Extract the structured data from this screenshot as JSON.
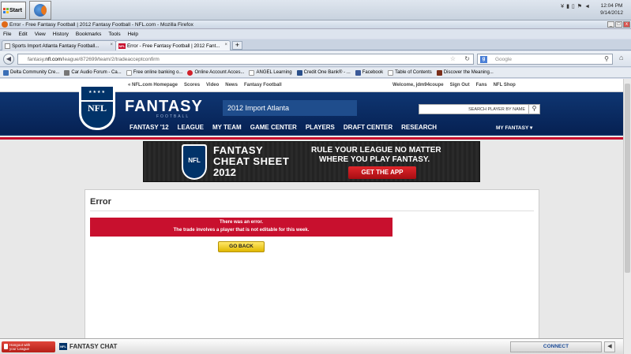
{
  "taskbar": {
    "start_label": "Start",
    "clock_time": "12:04 PM",
    "clock_date": "9/14/2012"
  },
  "window": {
    "title": "Error - Free Fantasy Football | 2012 Fantasy Football - NFL.com - Mozilla Firefox",
    "controls": [
      "_",
      "□",
      "x"
    ]
  },
  "menu": [
    "File",
    "Edit",
    "View",
    "History",
    "Bookmarks",
    "Tools",
    "Help"
  ],
  "tabs": [
    {
      "label": "Sports Import Atlanta Fantasy Football...",
      "active": false
    },
    {
      "label": "Error - Free Fantasy Football | 2012 Fant...",
      "active": true
    }
  ],
  "nav": {
    "url_prefix": "fantasy.",
    "url_domain": "nfl.com",
    "url_rest": "/league/872699/team/2/tradeacceptconfirm",
    "search_placeholder": "Google"
  },
  "bookmarks": [
    {
      "label": "Delta Community Cre...",
      "color": "#3b6fb6"
    },
    {
      "label": "Car Audio Forum - Ca...",
      "color": "#777777"
    },
    {
      "label": "Free online banking o...",
      "color": "#ffffff"
    },
    {
      "label": "Online Account Acces...",
      "color": "#d0202a"
    },
    {
      "label": "ANGEL Learning",
      "color": "#ffffff"
    },
    {
      "label": "Credit One Bank® - ...",
      "color": "#2a4f8a"
    },
    {
      "label": "Facebook",
      "color": "#3b5998"
    },
    {
      "label": "Table of Contents",
      "color": "#ffffff"
    },
    {
      "label": "Discover the Meaning...",
      "color": "#7a2e1a"
    }
  ],
  "nfl": {
    "top_left_links": [
      "« NFL.com Homepage",
      "Scores",
      "Video",
      "News",
      "Fantasy Football"
    ],
    "top_right_links": [
      "Welcome, jdm94coupe",
      "Sign Out",
      "Fans",
      "NFL Shop"
    ],
    "shield_text": "NFL",
    "brand": "FANTASY",
    "brand_sub": "FOOTBALL",
    "league_name": "2012 Import Atlanta",
    "player_search": "SEARCH PLAYER BY NAME",
    "main_nav": [
      "FANTASY '12",
      "LEAGUE",
      "MY TEAM",
      "GAME CENTER",
      "PLAYERS",
      "DRAFT CENTER",
      "RESEARCH"
    ],
    "my_fantasy": "MY FANTASY ▾"
  },
  "banner": {
    "line1": "FANTASY",
    "line2": "CHEAT SHEET",
    "line3": "2012",
    "tag1": "RULE YOUR LEAGUE NO MATTER",
    "tag2": "WHERE YOU PLAY FANTASY.",
    "cta": "GET THE APP"
  },
  "error": {
    "heading": "Error",
    "line1": "There was an error.",
    "line2": "The trade involves a player that is not editable for this week.",
    "go_back": "GO BACK"
  },
  "chat": {
    "hangout_line1": "Hangout with",
    "hangout_line2": "your League",
    "nfl_badge": "NFL",
    "label": "FANTASY CHAT",
    "connect": "CONNECT",
    "arrow": "◀"
  }
}
